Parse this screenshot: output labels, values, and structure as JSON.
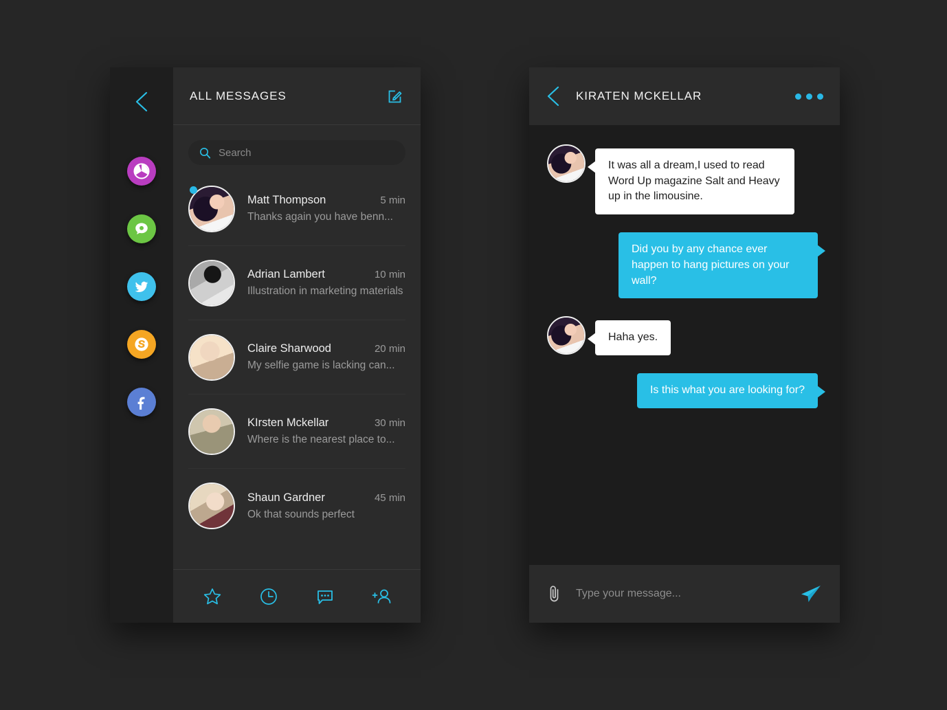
{
  "colors": {
    "page_background": "#262626",
    "rail_background": "#1e1e1e",
    "panel_background": "#2b2b2b",
    "chat_background": "#1c1c1c",
    "accent_cyan": "#29bfe6",
    "bubble_out": "#29bfe6",
    "bubble_in": "#ffffff",
    "social_photos": "#b93dc0",
    "social_messages": "#6cc644",
    "social_twitter": "#3fc1ec",
    "social_skype": "#f5a623",
    "social_facebook": "#5b7fd4"
  },
  "left_app": {
    "rail": {
      "back_icon": "chevron-left-icon",
      "items": [
        {
          "name": "photos",
          "icon": "aperture-icon",
          "color": "#b93dc0",
          "active": false
        },
        {
          "name": "messages",
          "icon": "chat-bubble-icon",
          "color": "#6cc644",
          "active": true
        },
        {
          "name": "twitter",
          "icon": "twitter-bird-icon",
          "color": "#3fc1ec",
          "active": false
        },
        {
          "name": "skype",
          "icon": "skype-icon",
          "color": "#f5a623",
          "active": false
        },
        {
          "name": "facebook",
          "icon": "facebook-icon",
          "color": "#5b7fd4",
          "active": false
        }
      ]
    },
    "header": {
      "title": "ALL MESSAGES",
      "compose_icon": "compose-edit-icon"
    },
    "search": {
      "placeholder": "Search",
      "icon": "search-icon"
    },
    "conversations": [
      {
        "name": "Matt Thompson",
        "preview": "Thanks again you have benn...",
        "time": "5 min",
        "unread": true,
        "avatar": "ph-kate"
      },
      {
        "name": "Adrian Lambert",
        "preview": "Illustration in marketing materials",
        "time": "10 min",
        "unread": false,
        "avatar": "ph-adrian"
      },
      {
        "name": "Claire Sharwood",
        "preview": "My selfie game is lacking can...",
        "time": "20 min",
        "unread": false,
        "avatar": "ph-claire"
      },
      {
        "name": "KIrsten Mckellar",
        "preview": "Where is the nearest place to...",
        "time": "30 min",
        "unread": false,
        "avatar": "ph-kirsten"
      },
      {
        "name": "Shaun Gardner",
        "preview": "Ok that sounds perfect",
        "time": "45 min",
        "unread": false,
        "avatar": "ph-shaun"
      }
    ],
    "footer": {
      "items": [
        {
          "name": "favorites",
          "icon": "star-icon"
        },
        {
          "name": "recent",
          "icon": "clock-icon"
        },
        {
          "name": "messages",
          "icon": "chat-dots-icon"
        },
        {
          "name": "add-contact",
          "icon": "add-person-icon"
        }
      ]
    }
  },
  "right_app": {
    "header": {
      "title": "KIRATEN MCKELLAR",
      "back_icon": "chevron-left-icon",
      "more_icon": "more-dots-icon"
    },
    "messages": [
      {
        "direction": "in",
        "text": "It was all a dream,I used to read Word Up magazine Salt and Heavy up in the limousine.",
        "avatar": "ph-kate"
      },
      {
        "direction": "out",
        "text": "Did you by any chance ever happen to hang pictures on your wall?"
      },
      {
        "direction": "in",
        "text": "Haha yes.",
        "avatar": "ph-kate"
      },
      {
        "direction": "out",
        "text": "Is this what you are looking for?"
      }
    ],
    "input": {
      "placeholder": "Type your message...",
      "attach_icon": "paperclip-icon",
      "send_icon": "send-paper-plane-icon"
    }
  }
}
